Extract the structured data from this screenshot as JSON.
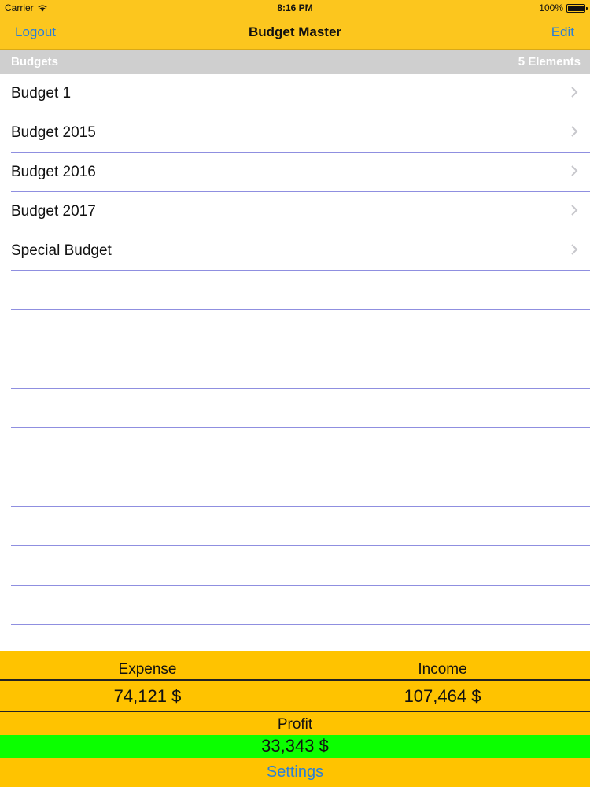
{
  "status_bar": {
    "carrier": "Carrier",
    "time": "8:16 PM",
    "battery": "100%"
  },
  "nav": {
    "left_label": "Logout",
    "title": "Budget Master",
    "right_label": "Edit"
  },
  "section": {
    "label": "Budgets",
    "count": "5 Elements"
  },
  "budgets": [
    "Budget 1",
    "Budget 2015",
    "Budget 2016",
    "Budget 2017",
    "Special Budget"
  ],
  "summary": {
    "expense_label": "Expense",
    "income_label": "Income",
    "expense_value": "74,121 $",
    "income_value": "107,464 $",
    "profit_label": "Profit",
    "profit_value": "33,343 $",
    "settings_label": "Settings"
  },
  "colors": {
    "nav_bar": "#FCC61E",
    "summary_bg": "#FFC300",
    "profit_bg": "#0BFF00",
    "link": "#2a7fd8",
    "row_separator": "#8f8fe0",
    "section_bg": "#cfcfcf"
  },
  "icons": {
    "wifi": "wifi-icon",
    "battery": "battery-icon",
    "chevron": "chevron-right-icon"
  }
}
